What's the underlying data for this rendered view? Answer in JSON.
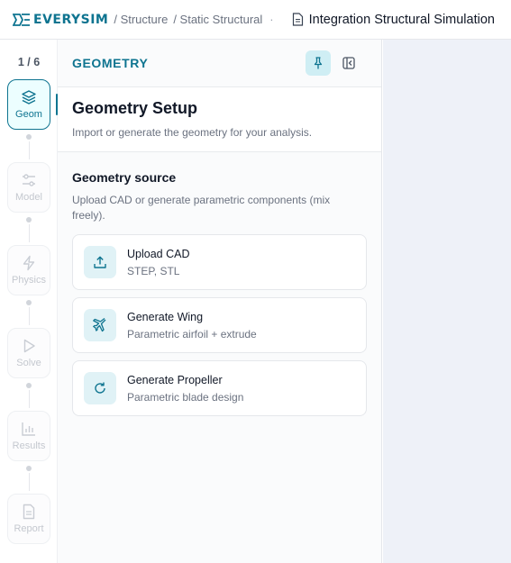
{
  "topbar": {
    "logo_text": "EVERYSIM",
    "breadcrumb": [
      "/ Structure",
      "/ Static Structural"
    ],
    "separator": "·",
    "project_title": "Integration Structural Simulation"
  },
  "rail": {
    "step_count": "1 / 6",
    "steps": [
      {
        "label": "Geom",
        "icon": "layers-icon",
        "active": true
      },
      {
        "label": "Model",
        "icon": "sliders-icon",
        "active": false
      },
      {
        "label": "Physics",
        "icon": "lightning-icon",
        "active": false
      },
      {
        "label": "Solve",
        "icon": "play-icon",
        "active": false
      },
      {
        "label": "Results",
        "icon": "bar-chart-icon",
        "active": false
      },
      {
        "label": "Report",
        "icon": "document-icon",
        "active": false
      }
    ]
  },
  "panel": {
    "title": "GEOMETRY",
    "setup_title": "Geometry Setup",
    "setup_sub": "Import or generate the geometry for your analysis.",
    "source_title": "Geometry source",
    "source_sub": "Upload CAD or generate parametric components (mix freely).",
    "cards": [
      {
        "title": "Upload CAD",
        "sub": "STEP, STL",
        "icon": "upload-icon"
      },
      {
        "title": "Generate Wing",
        "sub": "Parametric airfoil + extrude",
        "icon": "plane-icon"
      },
      {
        "title": "Generate Propeller",
        "sub": "Parametric blade design",
        "icon": "refresh-icon"
      }
    ]
  },
  "colors": {
    "accent": "#0e7490",
    "accent_bg": "#ecfeff",
    "right_bg": "#eef1f8"
  }
}
